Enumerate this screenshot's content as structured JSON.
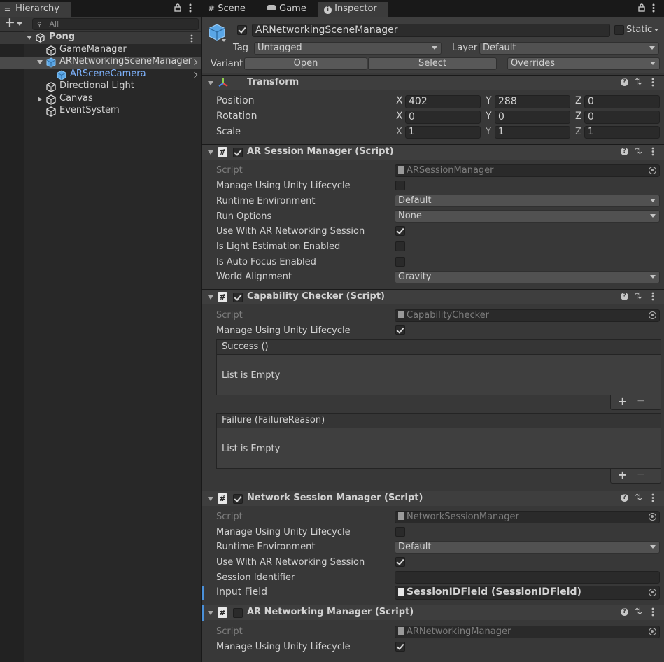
{
  "hierarchy": {
    "tab_label": "Hierarchy",
    "search_placeholder": "All",
    "add_label": "+",
    "scene_name": "Pong",
    "items": [
      {
        "label": "GameManager"
      },
      {
        "label": "ARNetworkingSceneManager"
      },
      {
        "label": "ARSceneCamera"
      },
      {
        "label": "Directional Light"
      },
      {
        "label": "Canvas"
      },
      {
        "label": "EventSystem"
      }
    ]
  },
  "tabs": [
    {
      "label": "Scene",
      "icon": "grid-icon"
    },
    {
      "label": "Game",
      "icon": "gamepad-icon"
    },
    {
      "label": "Inspector",
      "icon": "info-icon"
    }
  ],
  "object": {
    "name": "ARNetworkingSceneManager",
    "static_label": "Static",
    "tag_label": "Tag",
    "tag_value": "Untagged",
    "layer_label": "Layer",
    "layer_value": "Default",
    "variant_label": "Variant",
    "open_label": "Open",
    "select_label": "Select",
    "overrides_label": "Overrides"
  },
  "transform": {
    "title": "Transform",
    "position_label": "Position",
    "rotation_label": "Rotation",
    "scale_label": "Scale",
    "axis_x": "X",
    "axis_y": "Y",
    "axis_z": "Z",
    "position": {
      "x": "402",
      "y": "288",
      "z": "0"
    },
    "rotation": {
      "x": "0",
      "y": "0",
      "z": "0"
    },
    "scale": {
      "x": "1",
      "y": "1",
      "z": "1"
    }
  },
  "ar_session_manager": {
    "title": "AR Session Manager (Script)",
    "script_label": "Script",
    "script_value": "ARSessionManager",
    "manage_label": "Manage Using Unity Lifecycle",
    "runtime_label": "Runtime Environment",
    "runtime_value": "Default",
    "run_options_label": "Run Options",
    "run_options_value": "None",
    "use_with_label": "Use With AR Networking Session",
    "light_label": "Is Light Estimation Enabled",
    "autofocus_label": "Is Auto Focus Enabled",
    "world_label": "World Alignment",
    "world_value": "Gravity"
  },
  "capability_checker": {
    "title": "Capability Checker (Script)",
    "script_label": "Script",
    "script_value": "CapabilityChecker",
    "manage_label": "Manage Using Unity Lifecycle",
    "success_label": "Success ()",
    "failure_label": "Failure (FailureReason)",
    "empty_label": "List is Empty",
    "plus": "+",
    "minus": "−"
  },
  "network_session_manager": {
    "title": "Network Session Manager (Script)",
    "script_label": "Script",
    "script_value": "NetworkSessionManager",
    "manage_label": "Manage Using Unity Lifecycle",
    "runtime_label": "Runtime Environment",
    "runtime_value": "Default",
    "use_with_label": "Use With AR Networking Session",
    "session_id_label": "Session Identifier",
    "session_id_value": "",
    "input_label": "Input Field",
    "input_value": "SessionIDField (SessionIDField)"
  },
  "ar_networking_manager": {
    "title": "AR Networking Manager (Script)",
    "script_label": "Script",
    "script_value": "ARNetworkingManager",
    "manage_label": "Manage Using Unity Lifecycle"
  },
  "colors": {
    "selection": "#2c5d87",
    "highlight_text": "#7fb4ff"
  }
}
